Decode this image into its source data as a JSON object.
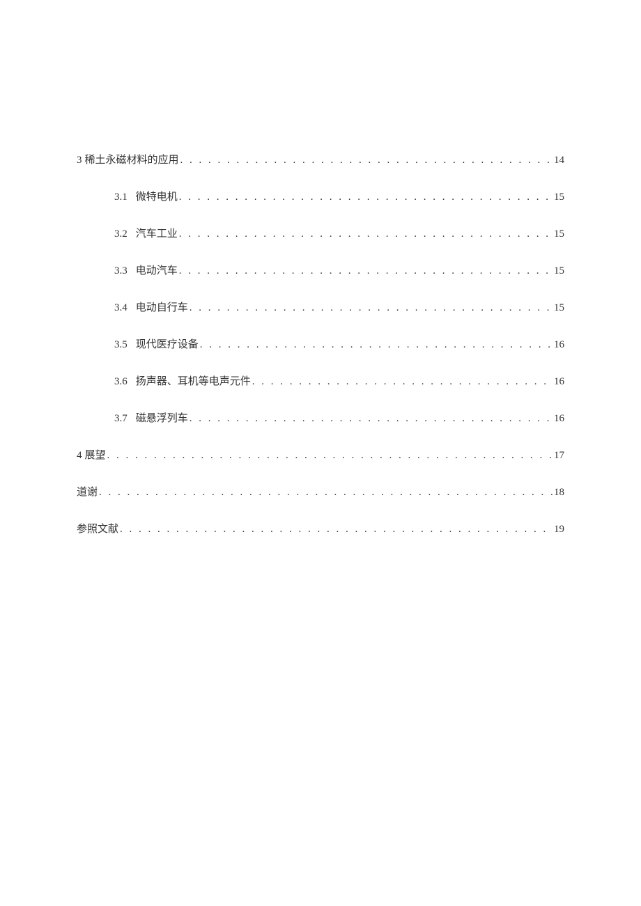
{
  "toc": {
    "leader": ". . . . . . . . . . . . . . . . . . . . . . . . . . . . . . . . . . . . . . . . . . . . . . . . . . . . . . . . . . . . . . . . . . . . . . . . . . . . . . . . . . . . . . . . . . . . . . . . . . . . . . . . . . . . . . . . . . . . . . . .",
    "entries": [
      {
        "level": 1,
        "num": "3",
        "title": "稀土永磁材料的应用",
        "page": "14"
      },
      {
        "level": 2,
        "num": "3.1",
        "title": "微特电机",
        "page": "15"
      },
      {
        "level": 2,
        "num": "3.2",
        "title": "汽车工业",
        "page": "15"
      },
      {
        "level": 2,
        "num": "3.3",
        "title": "电动汽车",
        "page": "15"
      },
      {
        "level": 2,
        "num": "3.4",
        "title": "电动自行车",
        "page": "15"
      },
      {
        "level": 2,
        "num": "3.5",
        "title": "现代医疗设备",
        "page": "16"
      },
      {
        "level": 2,
        "num": "3.6",
        "title": "扬声器、耳机等电声元件",
        "page": "16"
      },
      {
        "level": 2,
        "num": "3.7",
        "title": "磁悬浮列车",
        "page": "16"
      },
      {
        "level": 1,
        "num": "4",
        "title": "展望",
        "page": "17"
      },
      {
        "level": 1,
        "num": "",
        "title": "道谢",
        "page": "18"
      },
      {
        "level": 1,
        "num": "",
        "title": "参照文献",
        "page": "19"
      }
    ]
  }
}
